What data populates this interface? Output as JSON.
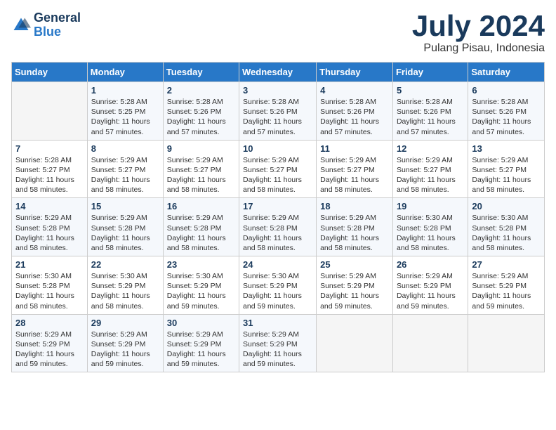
{
  "logo": {
    "general": "General",
    "blue": "Blue"
  },
  "title": "July 2024",
  "subtitle": "Pulang Pisau, Indonesia",
  "days_header": [
    "Sunday",
    "Monday",
    "Tuesday",
    "Wednesday",
    "Thursday",
    "Friday",
    "Saturday"
  ],
  "weeks": [
    [
      {
        "day": "",
        "info": ""
      },
      {
        "day": "1",
        "info": "Sunrise: 5:28 AM\nSunset: 5:25 PM\nDaylight: 11 hours\nand 57 minutes."
      },
      {
        "day": "2",
        "info": "Sunrise: 5:28 AM\nSunset: 5:26 PM\nDaylight: 11 hours\nand 57 minutes."
      },
      {
        "day": "3",
        "info": "Sunrise: 5:28 AM\nSunset: 5:26 PM\nDaylight: 11 hours\nand 57 minutes."
      },
      {
        "day": "4",
        "info": "Sunrise: 5:28 AM\nSunset: 5:26 PM\nDaylight: 11 hours\nand 57 minutes."
      },
      {
        "day": "5",
        "info": "Sunrise: 5:28 AM\nSunset: 5:26 PM\nDaylight: 11 hours\nand 57 minutes."
      },
      {
        "day": "6",
        "info": "Sunrise: 5:28 AM\nSunset: 5:26 PM\nDaylight: 11 hours\nand 57 minutes."
      }
    ],
    [
      {
        "day": "7",
        "info": "Sunrise: 5:28 AM\nSunset: 5:27 PM\nDaylight: 11 hours\nand 58 minutes."
      },
      {
        "day": "8",
        "info": "Sunrise: 5:29 AM\nSunset: 5:27 PM\nDaylight: 11 hours\nand 58 minutes."
      },
      {
        "day": "9",
        "info": "Sunrise: 5:29 AM\nSunset: 5:27 PM\nDaylight: 11 hours\nand 58 minutes."
      },
      {
        "day": "10",
        "info": "Sunrise: 5:29 AM\nSunset: 5:27 PM\nDaylight: 11 hours\nand 58 minutes."
      },
      {
        "day": "11",
        "info": "Sunrise: 5:29 AM\nSunset: 5:27 PM\nDaylight: 11 hours\nand 58 minutes."
      },
      {
        "day": "12",
        "info": "Sunrise: 5:29 AM\nSunset: 5:27 PM\nDaylight: 11 hours\nand 58 minutes."
      },
      {
        "day": "13",
        "info": "Sunrise: 5:29 AM\nSunset: 5:27 PM\nDaylight: 11 hours\nand 58 minutes."
      }
    ],
    [
      {
        "day": "14",
        "info": "Sunrise: 5:29 AM\nSunset: 5:28 PM\nDaylight: 11 hours\nand 58 minutes."
      },
      {
        "day": "15",
        "info": "Sunrise: 5:29 AM\nSunset: 5:28 PM\nDaylight: 11 hours\nand 58 minutes."
      },
      {
        "day": "16",
        "info": "Sunrise: 5:29 AM\nSunset: 5:28 PM\nDaylight: 11 hours\nand 58 minutes."
      },
      {
        "day": "17",
        "info": "Sunrise: 5:29 AM\nSunset: 5:28 PM\nDaylight: 11 hours\nand 58 minutes."
      },
      {
        "day": "18",
        "info": "Sunrise: 5:29 AM\nSunset: 5:28 PM\nDaylight: 11 hours\nand 58 minutes."
      },
      {
        "day": "19",
        "info": "Sunrise: 5:30 AM\nSunset: 5:28 PM\nDaylight: 11 hours\nand 58 minutes."
      },
      {
        "day": "20",
        "info": "Sunrise: 5:30 AM\nSunset: 5:28 PM\nDaylight: 11 hours\nand 58 minutes."
      }
    ],
    [
      {
        "day": "21",
        "info": "Sunrise: 5:30 AM\nSunset: 5:28 PM\nDaylight: 11 hours\nand 58 minutes."
      },
      {
        "day": "22",
        "info": "Sunrise: 5:30 AM\nSunset: 5:29 PM\nDaylight: 11 hours\nand 58 minutes."
      },
      {
        "day": "23",
        "info": "Sunrise: 5:30 AM\nSunset: 5:29 PM\nDaylight: 11 hours\nand 59 minutes."
      },
      {
        "day": "24",
        "info": "Sunrise: 5:30 AM\nSunset: 5:29 PM\nDaylight: 11 hours\nand 59 minutes."
      },
      {
        "day": "25",
        "info": "Sunrise: 5:29 AM\nSunset: 5:29 PM\nDaylight: 11 hours\nand 59 minutes."
      },
      {
        "day": "26",
        "info": "Sunrise: 5:29 AM\nSunset: 5:29 PM\nDaylight: 11 hours\nand 59 minutes."
      },
      {
        "day": "27",
        "info": "Sunrise: 5:29 AM\nSunset: 5:29 PM\nDaylight: 11 hours\nand 59 minutes."
      }
    ],
    [
      {
        "day": "28",
        "info": "Sunrise: 5:29 AM\nSunset: 5:29 PM\nDaylight: 11 hours\nand 59 minutes."
      },
      {
        "day": "29",
        "info": "Sunrise: 5:29 AM\nSunset: 5:29 PM\nDaylight: 11 hours\nand 59 minutes."
      },
      {
        "day": "30",
        "info": "Sunrise: 5:29 AM\nSunset: 5:29 PM\nDaylight: 11 hours\nand 59 minutes."
      },
      {
        "day": "31",
        "info": "Sunrise: 5:29 AM\nSunset: 5:29 PM\nDaylight: 11 hours\nand 59 minutes."
      },
      {
        "day": "",
        "info": ""
      },
      {
        "day": "",
        "info": ""
      },
      {
        "day": "",
        "info": ""
      }
    ]
  ]
}
